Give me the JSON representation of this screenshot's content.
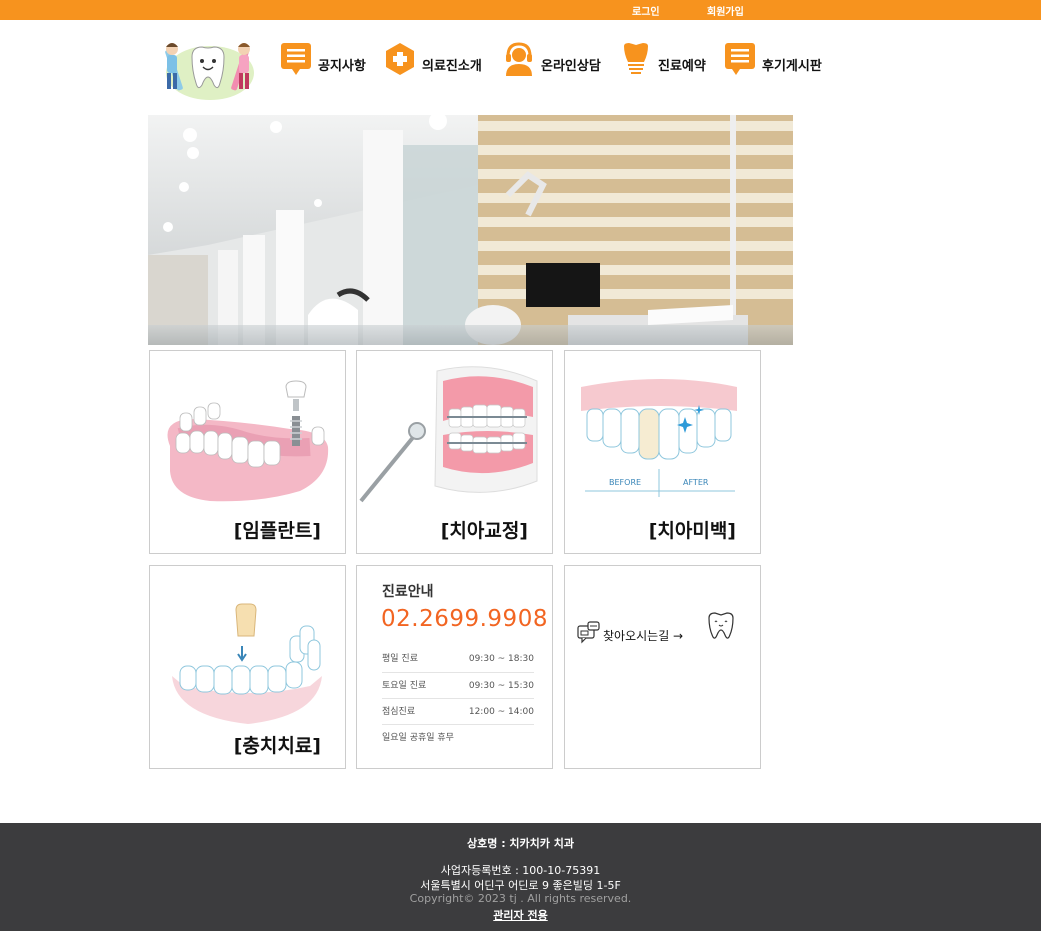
{
  "topbar": {
    "login": "로그인",
    "signup": "회원가입",
    "color": "#f7931e"
  },
  "nav": [
    {
      "label": "공지사항",
      "icon": "notice-icon"
    },
    {
      "label": "의료진소개",
      "icon": "medical-cross-icon"
    },
    {
      "label": "온라인상담",
      "icon": "headset-icon"
    },
    {
      "label": "진료예약",
      "icon": "tooth-icon"
    },
    {
      "label": "후기게시판",
      "icon": "board-icon"
    }
  ],
  "cards": {
    "implant": "[임플란트]",
    "ortho": "[치아교정]",
    "whitening": "[치아미백]",
    "cavity": "[충치치료]"
  },
  "whitening_image": {
    "before": "BEFORE",
    "after": "AFTER"
  },
  "hours": {
    "title": "진료안내",
    "phone": "02.2699.9908",
    "rows": [
      {
        "label": "평일 진료",
        "time": "09:30 ~ 18:30"
      },
      {
        "label": "토요일 진료",
        "time": "09:30 ~ 15:30"
      },
      {
        "label": "점심진료",
        "time": "12:00 ~ 14:00"
      },
      {
        "label": "일요일 공휴일 휴무",
        "time": ""
      }
    ]
  },
  "directions": {
    "label": "찾아오시는길 →",
    "icon": "map-chat-icon",
    "tooth_icon": "tooth-face-icon"
  },
  "footer": {
    "company": "상호명 : 치카치카 치과",
    "business_no": "사업자등록번호 : 100-10-75391",
    "address": "서울특별시 어딘구 어딘로 9 좋은빌딩 1-5F",
    "copyright": "Copyright© 2023 tj . All rights reserved.",
    "admin": "관리자 전용"
  },
  "colors": {
    "accent": "#f7931e",
    "phone": "#f26522",
    "footer_bg": "#3c3c3e"
  }
}
